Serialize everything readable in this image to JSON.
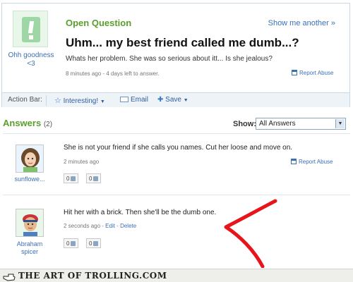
{
  "question": {
    "section_label": "Open Question",
    "show_another": "Show me another »",
    "asker_name": "Ohh goodness <3",
    "title": "Uhm... my best friend called me dumb...?",
    "body": "Whats her problem. She was so serious about itt... Is she jealous?",
    "meta": "8 minutes ago - 4 days left to answer.",
    "report_abuse": "Report Abuse"
  },
  "action_bar": {
    "label": "Action Bar:",
    "interesting": "Interesting!",
    "email": "Email",
    "save": "Save"
  },
  "answers_header": {
    "title": "Answers",
    "count": "(2)",
    "show_label": "Show:",
    "show_value": "All Answers"
  },
  "answers": [
    {
      "author": "sunflowe...",
      "text": "She is not your friend if she calls you names. Cut her loose and move on.",
      "meta": "2 minutes ago",
      "report_abuse": "Report Abuse",
      "thumbs_up": "0",
      "thumbs_down": "0"
    },
    {
      "author": "Abraham spicer",
      "text": "Hit her with a brick. Then she'll be the dumb one.",
      "meta": "2 seconds ago - ",
      "edit": "Edit",
      "meta_sep": " - ",
      "delete": "Delete",
      "thumbs_up": "0",
      "thumbs_down": "0"
    }
  ],
  "footer": {
    "brand": "THE ART OF TROLLING.COM"
  },
  "colors": {
    "green_heading": "#5a9e2b",
    "link_blue": "#3b6fb6",
    "arrow_red": "#e8141b"
  },
  "icons": [
    "question-mark-icon",
    "star-icon",
    "email-icon",
    "plus-icon",
    "flag-icon",
    "thumbs-up-icon",
    "thumbs-down-icon",
    "dropdown-arrow-icon",
    "hand-pointer-icon"
  ]
}
